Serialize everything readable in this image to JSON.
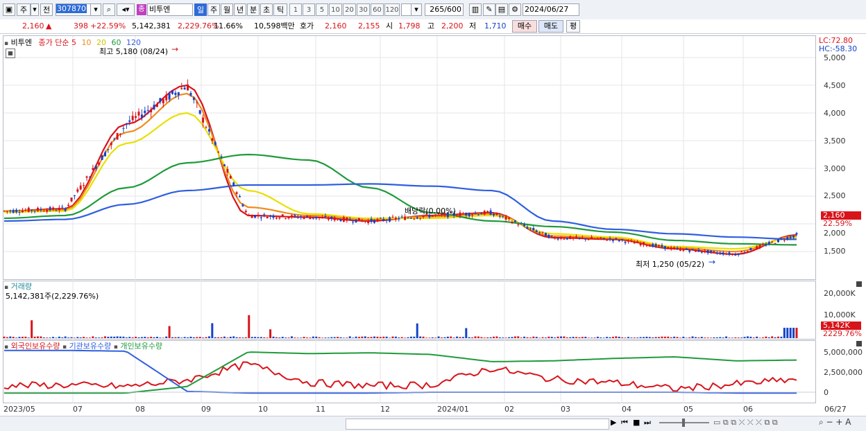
{
  "toolbar": {
    "type_label": "주",
    "prev_label": "전",
    "code_value": "307870",
    "stock_name": "비투엔",
    "stock_badge": "종",
    "periods": [
      "일",
      "주",
      "월",
      "년",
      "분",
      "초",
      "틱"
    ],
    "numbers": [
      "1",
      "3",
      "5",
      "10",
      "20",
      "30",
      "60",
      "120"
    ],
    "count_value": "265",
    "count_total": "/600",
    "date_value": "2024/06/27"
  },
  "quote": {
    "price": "2,160",
    "change": "398",
    "change_pct": "+22.59%",
    "volume": "5,142,381",
    "volume_pct": "2,229.76%",
    "turnover": "11.66%",
    "amount": "10,598백만",
    "ask_label": "호가",
    "ask_sell": "2,160",
    "ask_buy": "2,155",
    "open_label": "시",
    "open": "1,798",
    "high_label": "고",
    "high": "2,200",
    "low_label": "저",
    "low": "1,710",
    "buy_btn": "매수",
    "sell_btn": "매도",
    "eval_btn": "평"
  },
  "price_panel": {
    "name": "비투엔",
    "ma_label": "종가 단순",
    "ma_periods": [
      "5",
      "10",
      "20",
      "60",
      "120"
    ],
    "ma_colors": [
      "#d8141b",
      "#f08a1c",
      "#e8e000",
      "#1f9a3a",
      "#2f5ee0"
    ],
    "high_note": "최고 5,180 (08/24)",
    "low_note": "최저 1,250 (05/22)",
    "dividend_note": "배당락(0.00%)",
    "lc": "LC:72.80",
    "hc": "HC:-58.30",
    "last_price_tag": "2,160",
    "last_pct_tag": "22.59%",
    "y_ticks": [
      "5,000",
      "4,500",
      "4,000",
      "3,500",
      "3,000",
      "2,500",
      "2,000",
      "1,500"
    ]
  },
  "volume_panel": {
    "title": "거래량",
    "value": "5,142,381주(2,229.76%)",
    "y_ticks": [
      "20,000K",
      "10,000K"
    ],
    "last_tag": "5,142K",
    "last_pct": "2229.76%"
  },
  "holding_panel": {
    "series": [
      "외국인보유수량",
      "기관보유수량",
      "개인보유수량"
    ],
    "series_colors": [
      "#d8141b",
      "#2f5ee0",
      "#1f9a3a"
    ],
    "y_ticks": [
      "5,000,000",
      "2,500,000",
      "0"
    ]
  },
  "x_axis": [
    "2023/05",
    "07",
    "08",
    "09",
    "10",
    "11",
    "12",
    "2024/01",
    "02",
    "03",
    "04",
    "05",
    "06",
    "06/27"
  ],
  "chart_data": {
    "type": "line",
    "title": "",
    "xlabel": "",
    "ylabel": "",
    "x": [
      "2023/05",
      "2023/06",
      "2023/07",
      "2023/08",
      "2023/09",
      "2023/10",
      "2023/11",
      "2023/12",
      "2024/01",
      "2024/02",
      "2024/03",
      "2024/04",
      "2024/05",
      "2024/06"
    ],
    "ylim": [
      1250,
      5300
    ],
    "series": [
      {
        "name": "5",
        "values": [
          2230,
          2270,
          3800,
          4500,
          2150,
          2120,
          2050,
          2150,
          2200,
          1750,
          1720,
          1550,
          1450,
          1800
        ]
      },
      {
        "name": "10",
        "values": [
          2230,
          2250,
          3650,
          4350,
          2300,
          2150,
          2080,
          2130,
          2180,
          1780,
          1740,
          1570,
          1500,
          1780
        ]
      },
      {
        "name": "20",
        "values": [
          2210,
          2230,
          3450,
          4000,
          2600,
          2180,
          2100,
          2100,
          2150,
          1820,
          1760,
          1590,
          1550,
          1750
        ]
      },
      {
        "name": "60",
        "values": [
          2100,
          2150,
          2650,
          3100,
          3250,
          3150,
          2650,
          2200,
          2050,
          1950,
          1850,
          1700,
          1640,
          1620
        ]
      },
      {
        "name": "120",
        "values": [
          2050,
          2080,
          2350,
          2600,
          2700,
          2700,
          2720,
          2680,
          2600,
          2050,
          1900,
          1820,
          1760,
          1720
        ]
      }
    ],
    "volume_peak": "5,142,381",
    "volume_range": [
      0,
      22000
    ],
    "holding_range": [
      0,
      5500000
    ]
  }
}
